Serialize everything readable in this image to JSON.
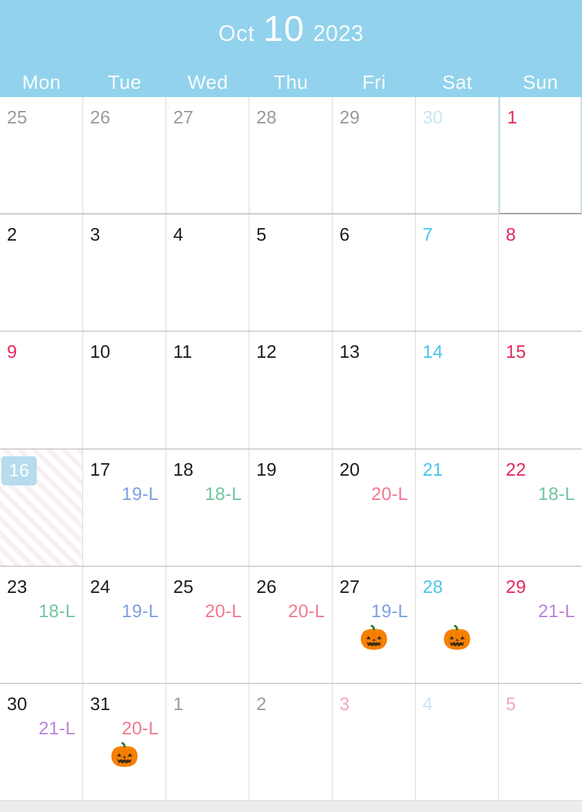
{
  "theme": {
    "header_bg": "#92d2ec",
    "weekday_color": "#1c1c1c",
    "saturday_color": "#4cc6e8",
    "sunday_color": "#e3295c",
    "other_month_color": "#9a9a9a",
    "selected_badge_bg": "#b6dcee",
    "selected_cell_border": "#c6e2ef",
    "event_green": "#6ec79e",
    "event_blue": "#7f9fe0",
    "event_pink": "#f2798f",
    "event_purple": "#bb84d8",
    "footer_strip": "#ececec"
  },
  "header": {
    "month_abbr": "Oct",
    "month_number": "10",
    "year": "2023",
    "weekdays": [
      "Mon",
      "Tue",
      "Wed",
      "Thu",
      "Fri",
      "Sat",
      "Sun"
    ]
  },
  "weeks": [
    {
      "days": [
        {
          "num": "25",
          "kind": "other"
        },
        {
          "num": "26",
          "kind": "other"
        },
        {
          "num": "27",
          "kind": "other"
        },
        {
          "num": "28",
          "kind": "other"
        },
        {
          "num": "29",
          "kind": "other"
        },
        {
          "num": "30",
          "kind": "other-sat"
        },
        {
          "num": "1",
          "kind": "sun",
          "selected_outline": true
        }
      ]
    },
    {
      "days": [
        {
          "num": "2",
          "kind": "weekday"
        },
        {
          "num": "3",
          "kind": "weekday"
        },
        {
          "num": "4",
          "kind": "weekday"
        },
        {
          "num": "5",
          "kind": "weekday"
        },
        {
          "num": "6",
          "kind": "weekday"
        },
        {
          "num": "7",
          "kind": "sat"
        },
        {
          "num": "8",
          "kind": "sun"
        }
      ]
    },
    {
      "days": [
        {
          "num": "9",
          "kind": "sun"
        },
        {
          "num": "10",
          "kind": "weekday"
        },
        {
          "num": "11",
          "kind": "weekday"
        },
        {
          "num": "12",
          "kind": "weekday"
        },
        {
          "num": "13",
          "kind": "weekday"
        },
        {
          "num": "14",
          "kind": "sat"
        },
        {
          "num": "15",
          "kind": "sun"
        }
      ]
    },
    {
      "days": [
        {
          "num": "16",
          "kind": "weekday",
          "today": true,
          "striped": true
        },
        {
          "num": "17",
          "kind": "weekday",
          "event": "19-L",
          "event_color": "blue"
        },
        {
          "num": "18",
          "kind": "weekday",
          "event": "18-L",
          "event_color": "green"
        },
        {
          "num": "19",
          "kind": "weekday"
        },
        {
          "num": "20",
          "kind": "weekday",
          "event": "20-L",
          "event_color": "pink"
        },
        {
          "num": "21",
          "kind": "sat"
        },
        {
          "num": "22",
          "kind": "sun",
          "event": "18-L",
          "event_color": "green"
        }
      ]
    },
    {
      "days": [
        {
          "num": "23",
          "kind": "weekday",
          "event": "18-L",
          "event_color": "green"
        },
        {
          "num": "24",
          "kind": "weekday",
          "event": "19-L",
          "event_color": "blue"
        },
        {
          "num": "25",
          "kind": "weekday",
          "event": "20-L",
          "event_color": "pink"
        },
        {
          "num": "26",
          "kind": "weekday",
          "event": "20-L",
          "event_color": "pink"
        },
        {
          "num": "27",
          "kind": "weekday",
          "event": "19-L",
          "event_color": "blue",
          "emoji": "🎃",
          "emoji_name": "jack-o-lantern-icon"
        },
        {
          "num": "28",
          "kind": "sat",
          "emoji": "🎃",
          "emoji_name": "jack-o-lantern-icon"
        },
        {
          "num": "29",
          "kind": "sun",
          "event": "21-L",
          "event_color": "purple"
        }
      ]
    },
    {
      "days": [
        {
          "num": "30",
          "kind": "weekday",
          "event": "21-L",
          "event_color": "purple"
        },
        {
          "num": "31",
          "kind": "weekday",
          "event": "20-L",
          "event_color": "pink",
          "emoji": "🎃",
          "emoji_name": "jack-o-lantern-icon"
        },
        {
          "num": "1",
          "kind": "other"
        },
        {
          "num": "2",
          "kind": "other"
        },
        {
          "num": "3",
          "kind": "other-hol"
        },
        {
          "num": "4",
          "kind": "other-sat"
        },
        {
          "num": "5",
          "kind": "other-sun"
        }
      ]
    }
  ]
}
